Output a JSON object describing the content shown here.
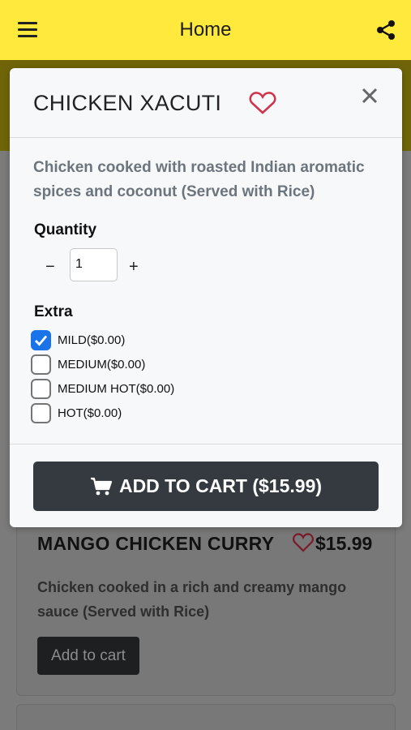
{
  "header": {
    "title": "Home",
    "menu_icon": "hamburger-menu-icon",
    "share_icon": "share-icon"
  },
  "modal": {
    "title": "CHICKEN XACUTI",
    "description": "Chicken cooked with roasted Indian aromatic spices and coconut (Served with Rice)",
    "quantity_label": "Quantity",
    "minus": "−",
    "quantity_value": "1",
    "plus": "+",
    "extra_label": "Extra",
    "options": [
      {
        "label": "MILD($0.00)",
        "checked": true
      },
      {
        "label": "MEDIUM($0.00)",
        "checked": false
      },
      {
        "label": "MEDIUM HOT($0.00)",
        "checked": false
      },
      {
        "label": "HOT($0.00)",
        "checked": false
      }
    ],
    "add_to_cart_label": "ADD TO CART ($15.99)",
    "accent_color": "#1a73e8",
    "heart_color": "#d0344d"
  },
  "background_items": [
    {
      "name": "MANGO CHICKEN CURRY",
      "price": "$15.99",
      "description": "Chicken cooked in a rich and creamy mango sauce (Served with Rice)",
      "button": "Add to cart"
    }
  ]
}
